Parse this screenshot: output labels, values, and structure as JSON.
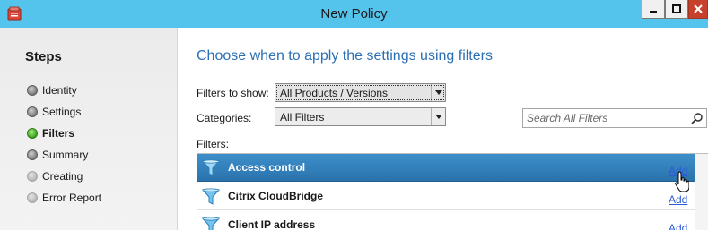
{
  "window": {
    "title": "New Policy",
    "app_icon": "citrix-studio-icon",
    "controls": {
      "minimize": "minimize-icon",
      "maximize": "maximize-icon",
      "close": "close-icon"
    },
    "titlebar_color": "#55c4ec"
  },
  "steps": {
    "title": "Steps",
    "items": [
      {
        "label": "Identity",
        "state": "completed"
      },
      {
        "label": "Settings",
        "state": "completed"
      },
      {
        "label": "Filters",
        "state": "active"
      },
      {
        "label": "Summary",
        "state": "pending"
      },
      {
        "label": "Creating",
        "state": "pending"
      },
      {
        "label": "Error Report",
        "state": "pending"
      }
    ]
  },
  "main": {
    "heading": "Choose when to apply the settings using filters",
    "filters_to_show": {
      "label": "Filters to show:",
      "value": "All Products / Versions"
    },
    "categories": {
      "label": "Categories:",
      "value": "All Filters"
    },
    "search": {
      "placeholder": "Search All Filters",
      "value": ""
    },
    "filters_label": "Filters:",
    "filters": [
      {
        "name": "Access control",
        "action": "Add",
        "selected": true
      },
      {
        "name": "Citrix CloudBridge",
        "action": "Add",
        "selected": false
      },
      {
        "name": "Client IP address",
        "action": "Add",
        "selected": false
      }
    ]
  },
  "colors": {
    "accent_heading": "#2a6fb6",
    "selected_row": "#2a73ad",
    "link": "#2c5bd8",
    "active_step": "#3aa11d"
  }
}
